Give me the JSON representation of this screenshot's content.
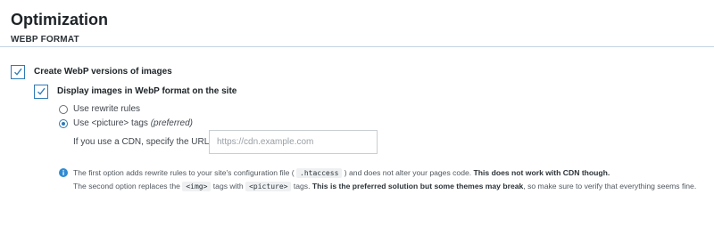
{
  "page": {
    "title": "Optimization",
    "section_label": "WEBP FORMAT"
  },
  "options": {
    "create_webp": {
      "label": "Create WebP versions of images",
      "checked": true
    },
    "display_webp": {
      "label": "Display images in WebP format on the site",
      "checked": true
    },
    "method": {
      "rewrite_label": "Use rewrite rules",
      "picture_label": "Use <picture> tags",
      "picture_hint": "(preferred)",
      "selected": "picture"
    },
    "cdn": {
      "label": "If you use a CDN, specify the URL:",
      "placeholder": "https://cdn.example.com",
      "value": ""
    }
  },
  "note": {
    "line1_a": "The first option adds rewrite rules to your site's configuration file (",
    "line1_code": ".htaccess",
    "line1_b": ") and does not alter your pages code.",
    "line1_strong": "This does not work with CDN though.",
    "line2_a": "The second option replaces the",
    "line2_code1": "<img>",
    "line2_b": "tags with",
    "line2_code2": "<picture>",
    "line2_c": "tags.",
    "line2_strong": "This is the preferred solution but some themes may break",
    "line2_d": ", so make sure to verify that everything seems fine."
  },
  "icons": {
    "checkbox_check": "checkmark-icon",
    "info": "info-icon"
  },
  "colors": {
    "accent": "#2f7ab6",
    "info": "#2f8bd3",
    "divider": "#c3d3e3"
  }
}
